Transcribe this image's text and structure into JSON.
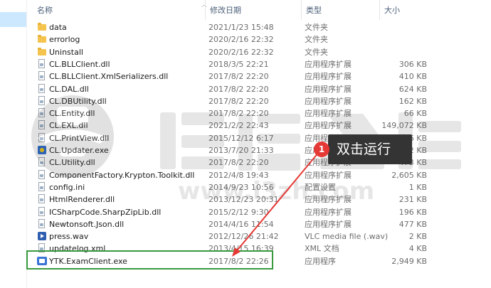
{
  "header": {
    "columns": [
      {
        "label": "名称"
      },
      {
        "label": "修改日期"
      },
      {
        "label": "类型"
      },
      {
        "label": "大小"
      }
    ]
  },
  "files": [
    {
      "icon": "folder-icon",
      "name": "data",
      "date": "2021/1/23 15:48",
      "type": "文件夹",
      "size": ""
    },
    {
      "icon": "folder-icon",
      "name": "errorlog",
      "date": "2020/2/16 22:32",
      "type": "文件夹",
      "size": ""
    },
    {
      "icon": "folder-icon",
      "name": "Uninstall",
      "date": "2020/2/16 22:32",
      "type": "文件夹",
      "size": ""
    },
    {
      "icon": "dll-file-icon",
      "name": "CL.BLLClient.dll",
      "date": "2018/3/5 22:21",
      "type": "应用程序扩展",
      "size": "306 KB"
    },
    {
      "icon": "dll-file-icon",
      "name": "CL.BLLClient.XmlSerializers.dll",
      "date": "2017/8/2 22:20",
      "type": "应用程序扩展",
      "size": "410 KB"
    },
    {
      "icon": "dll-file-icon",
      "name": "CL.DAL.dll",
      "date": "2017/8/2 22:20",
      "type": "应用程序扩展",
      "size": "624 KB"
    },
    {
      "icon": "dll-file-icon",
      "name": "CL.DBUtility.dll",
      "date": "2017/8/2 22:20",
      "type": "应用程序扩展",
      "size": "162 KB"
    },
    {
      "icon": "dll-file-icon",
      "name": "CL.Entity.dll",
      "date": "2017/8/2 22:20",
      "type": "应用程序扩展",
      "size": "66 KB"
    },
    {
      "icon": "dll-file-icon",
      "name": "CL.EXL.dll",
      "date": "2021/2/2 22:43",
      "type": "应用程序扩展",
      "size": "149,072 KB"
    },
    {
      "icon": "dll-file-icon",
      "name": "CL.PrintView.dll",
      "date": "2015/12/12 6:17",
      "type": "应用程序扩展",
      "size": "156 KB"
    },
    {
      "icon": "app-icon",
      "name": "CL.Updater.exe",
      "date": "2013/7/20 21:33",
      "type": "应用程序",
      "size": "52 KB"
    },
    {
      "icon": "dll-file-icon",
      "name": "CL.Utility.dll",
      "date": "2017/8/2 22:20",
      "type": "应用程序扩展",
      "size": "473 KB"
    },
    {
      "icon": "dll-file-icon",
      "name": "ComponentFactory.Krypton.Toolkit.dll",
      "date": "2012/4/8 19:43",
      "type": "应用程序扩展",
      "size": "2,605 KB"
    },
    {
      "icon": "ini-file-icon",
      "name": "config.ini",
      "date": "2014/9/23 10:56",
      "type": "配置设置",
      "size": "1 KB"
    },
    {
      "icon": "dll-file-icon",
      "name": "HtmlRenderer.dll",
      "date": "2013/12/23 20:31",
      "type": "应用程序扩展",
      "size": "231 KB"
    },
    {
      "icon": "dll-file-icon",
      "name": "ICSharpCode.SharpZipLib.dll",
      "date": "2015/2/12 9:30",
      "type": "应用程序扩展",
      "size": "196 KB"
    },
    {
      "icon": "dll-file-icon",
      "name": "Newtonsoft.Json.dll",
      "date": "2014/4/16 11:54",
      "type": "应用程序扩展",
      "size": "477 KB"
    },
    {
      "icon": "media-file-icon",
      "name": "press.wav",
      "date": "2012/12/26 21:42",
      "type": "VLC media file (.wav)",
      "size": "2 KB"
    },
    {
      "icon": "xml-file-icon",
      "name": "updatelog.xml",
      "date": "2013/4/15 16:39",
      "type": "XML 文档",
      "size": "4 KB"
    },
    {
      "icon": "exe-app-icon",
      "name": "YTK.ExamClient.exe",
      "date": "2017/8/2 22:26",
      "type": "应用程序",
      "size": "2,949 KB"
    }
  ],
  "callout": {
    "number": "1",
    "label": "双击运行"
  },
  "colors": {
    "highlight": "#3a9a3f",
    "callout_dot": "#e53935",
    "callout_bg": "#343434",
    "arrow": "#e53935",
    "selection": "#cce8ff"
  }
}
